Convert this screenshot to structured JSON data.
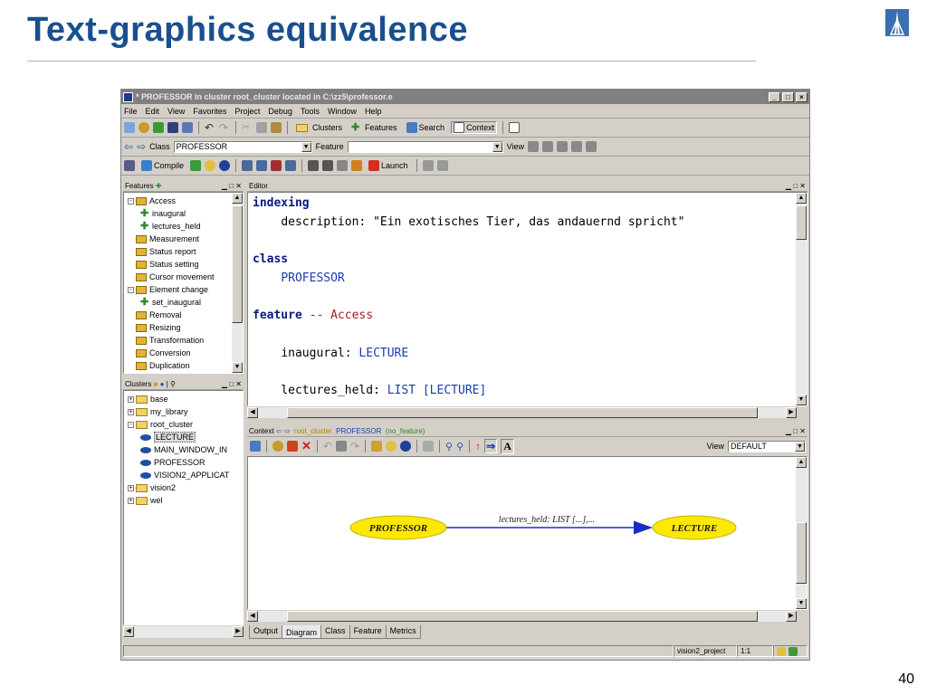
{
  "slide": {
    "title": "Text-graphics equivalence",
    "page_number": "40"
  },
  "window": {
    "title": "* PROFESSOR  in cluster root_cluster  located in C:\\zz5\\professor.e",
    "menu": [
      "File",
      "Edit",
      "View",
      "Favorites",
      "Project",
      "Debug",
      "Tools",
      "Window",
      "Help"
    ],
    "toolbar1": {
      "clusters": "Clusters",
      "features": "Features",
      "search": "Search",
      "context": "Context"
    },
    "address": {
      "class_label": "Class",
      "class_value": "PROFESSOR",
      "feature_label": "Feature",
      "feature_value": "",
      "view_label": "View"
    },
    "toolbar3": {
      "compile": "Compile",
      "launch": "Launch"
    }
  },
  "features_pane": {
    "title": "Features",
    "items": [
      {
        "label": "Access",
        "kind": "folder",
        "expander": "-",
        "level": 0
      },
      {
        "label": "inaugural",
        "kind": "feature",
        "level": 1
      },
      {
        "label": "lectures_held",
        "kind": "feature",
        "level": 1
      },
      {
        "label": "Measurement",
        "kind": "folder",
        "level": 0
      },
      {
        "label": "Status report",
        "kind": "folder",
        "level": 0
      },
      {
        "label": "Status setting",
        "kind": "folder",
        "level": 0
      },
      {
        "label": "Cursor movement",
        "kind": "folder",
        "level": 0
      },
      {
        "label": "Element change",
        "kind": "folder",
        "expander": "-",
        "level": 0
      },
      {
        "label": "set_inaugural",
        "kind": "feature",
        "level": 1
      },
      {
        "label": "Removal",
        "kind": "folder",
        "level": 0
      },
      {
        "label": "Resizing",
        "kind": "folder",
        "level": 0
      },
      {
        "label": "Transformation",
        "kind": "folder",
        "level": 0
      },
      {
        "label": "Conversion",
        "kind": "folder",
        "level": 0
      },
      {
        "label": "Duplication",
        "kind": "folder",
        "level": 0
      }
    ]
  },
  "clusters_pane": {
    "title": "Clusters",
    "items": [
      {
        "label": "base",
        "kind": "cluster",
        "expander": "+",
        "level": 0
      },
      {
        "label": "my_library",
        "kind": "cluster",
        "expander": "+",
        "level": 0
      },
      {
        "label": "root_cluster",
        "kind": "cluster",
        "expander": "-",
        "level": 0
      },
      {
        "label": "LECTURE",
        "kind": "class",
        "level": 1
      },
      {
        "label": "MAIN_WINDOW_IN",
        "kind": "class",
        "level": 1
      },
      {
        "label": "PROFESSOR",
        "kind": "class",
        "level": 1
      },
      {
        "label": "VISION2_APPLICAT",
        "kind": "class",
        "level": 1
      },
      {
        "label": "vision2",
        "kind": "cluster",
        "expander": "+",
        "level": 0
      },
      {
        "label": "wel",
        "kind": "cluster",
        "expander": "+",
        "level": 0
      }
    ]
  },
  "editor": {
    "title": "Editor",
    "code": {
      "indexing_kw": "indexing",
      "description_label": "description:",
      "description_value": "\"Ein exotisches Tier, das andauernd spricht\"",
      "class_kw": "class",
      "class_name": "PROFESSOR",
      "feature_kw": "feature",
      "feature_comment": "-- Access",
      "inaugural_name": "inaugural:",
      "inaugural_type": "LECTURE",
      "lectures_name": "lectures_held:",
      "lectures_type_a": "LIST",
      "lectures_type_b": "[LECTURE]"
    }
  },
  "context": {
    "title": "Context",
    "cluster": "root_cluster",
    "class": "PROFESSOR",
    "feature": "(no_feature)",
    "view_label": "View",
    "view_value": "DEFAULT",
    "diagram": {
      "source": "PROFESSOR",
      "target": "LECTURE",
      "link_label": "lectures_held: LIST [...],..."
    },
    "tabs": [
      "Output",
      "Diagram",
      "Class",
      "Feature",
      "Metrics"
    ],
    "active_tab": "Diagram"
  },
  "statusbar": {
    "project": "vision2_project",
    "position": "1:1"
  },
  "colors": {
    "title_blue": "#1a4f8f",
    "bubble_yellow": "#ffe800",
    "link_blue": "#1a2cc8"
  }
}
